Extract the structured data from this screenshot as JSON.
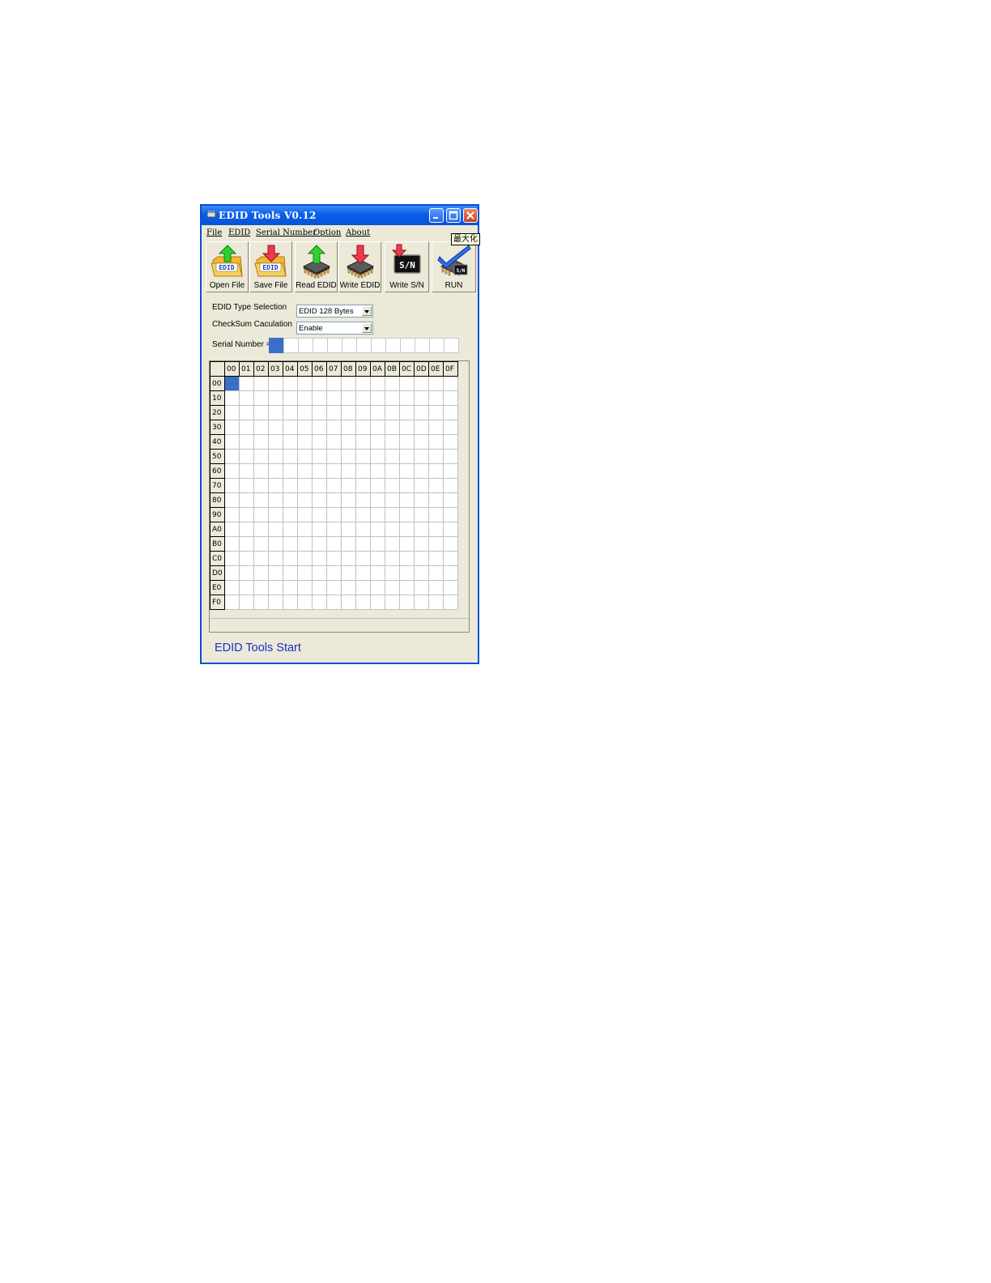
{
  "window": {
    "title": "EDID Tools V0.12",
    "tooltip": "最大化"
  },
  "menu": [
    "File",
    "EDID",
    "Serial Number",
    "Option",
    "About"
  ],
  "toolbar": {
    "open_file": "Open File",
    "save_file": "Save File",
    "read_edid": "Read EDID",
    "write_edid": "Write EDID",
    "write_sn": "Write S/N",
    "run": "RUN",
    "edid_badge": "EDID",
    "sn_badge": "S/N"
  },
  "form": {
    "edid_type_label": "EDID Type Selection",
    "edid_type_value": "EDID 128 Bytes",
    "checksum_label": "CheckSum Caculation",
    "checksum_value": "Enable",
    "serial_label": "Serial Number ="
  },
  "grid": {
    "columns": [
      "00",
      "01",
      "02",
      "03",
      "04",
      "05",
      "06",
      "07",
      "08",
      "09",
      "0A",
      "0B",
      "0C",
      "0D",
      "0E",
      "0F"
    ],
    "rows": [
      "00",
      "10",
      "20",
      "30",
      "40",
      "50",
      "60",
      "70",
      "80",
      "90",
      "A0",
      "B0",
      "C0",
      "D0",
      "E0",
      "F0"
    ]
  },
  "status": "EDID Tools Start",
  "colors": {
    "title_bar": "#0a5ee8",
    "selection": "#3a6fc9",
    "status_text": "#1a2ec8"
  }
}
